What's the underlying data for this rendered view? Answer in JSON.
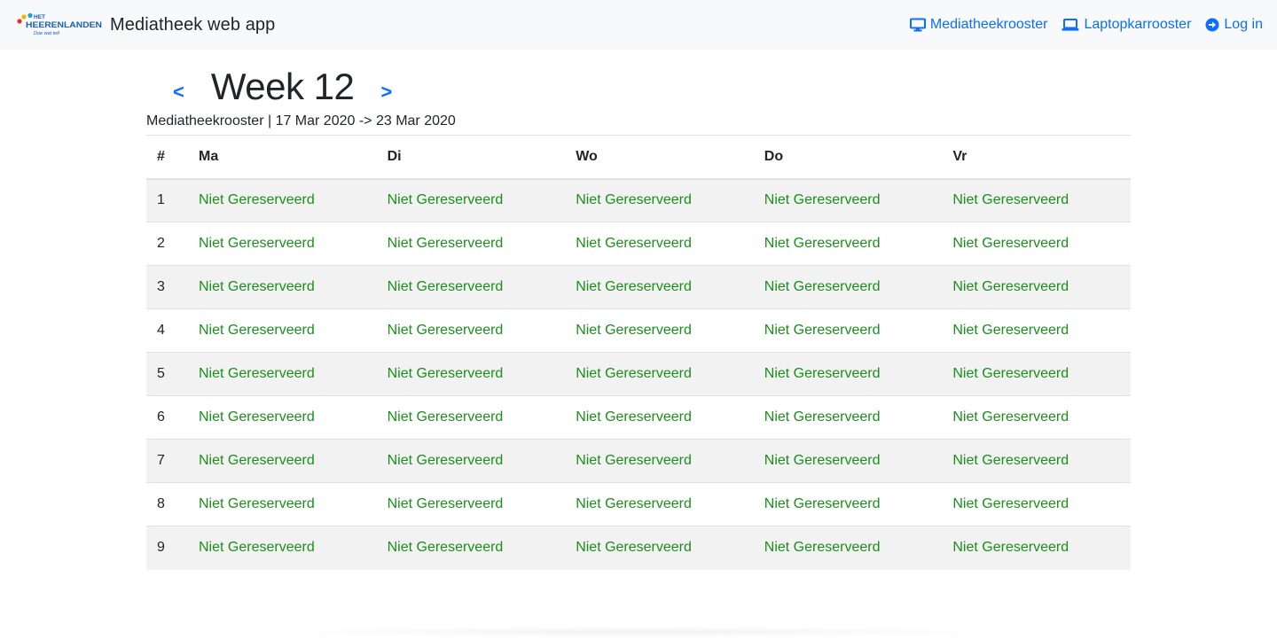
{
  "navbar": {
    "brand_title": "Mediatheek web app",
    "logo_text_top": "HET",
    "logo_text_main": "HEERENLANDEN",
    "logo_text_sub": "Doe wat telt",
    "links": [
      {
        "label": "Mediatheekrooster",
        "icon": "monitor-icon"
      },
      {
        "label": "Laptopkarrooster",
        "icon": "laptop-icon"
      },
      {
        "label": "Log in",
        "icon": "sign-in-icon"
      }
    ]
  },
  "week": {
    "prev_label": "<",
    "title": "Week 12",
    "next_label": ">",
    "subtitle": "Mediatheekrooster | 17 Mar 2020 -> 23 Mar 2020"
  },
  "table": {
    "headers": [
      "#",
      "Ma",
      "Di",
      "Wo",
      "Do",
      "Vr"
    ],
    "rows": [
      {
        "num": "1",
        "slots": [
          "Niet Gereserveerd",
          "Niet Gereserveerd",
          "Niet Gereserveerd",
          "Niet Gereserveerd",
          "Niet Gereserveerd"
        ]
      },
      {
        "num": "2",
        "slots": [
          "Niet Gereserveerd",
          "Niet Gereserveerd",
          "Niet Gereserveerd",
          "Niet Gereserveerd",
          "Niet Gereserveerd"
        ]
      },
      {
        "num": "3",
        "slots": [
          "Niet Gereserveerd",
          "Niet Gereserveerd",
          "Niet Gereserveerd",
          "Niet Gereserveerd",
          "Niet Gereserveerd"
        ]
      },
      {
        "num": "4",
        "slots": [
          "Niet Gereserveerd",
          "Niet Gereserveerd",
          "Niet Gereserveerd",
          "Niet Gereserveerd",
          "Niet Gereserveerd"
        ]
      },
      {
        "num": "5",
        "slots": [
          "Niet Gereserveerd",
          "Niet Gereserveerd",
          "Niet Gereserveerd",
          "Niet Gereserveerd",
          "Niet Gereserveerd"
        ]
      },
      {
        "num": "6",
        "slots": [
          "Niet Gereserveerd",
          "Niet Gereserveerd",
          "Niet Gereserveerd",
          "Niet Gereserveerd",
          "Niet Gereserveerd"
        ]
      },
      {
        "num": "7",
        "slots": [
          "Niet Gereserveerd",
          "Niet Gereserveerd",
          "Niet Gereserveerd",
          "Niet Gereserveerd",
          "Niet Gereserveerd"
        ]
      },
      {
        "num": "8",
        "slots": [
          "Niet Gereserveerd",
          "Niet Gereserveerd",
          "Niet Gereserveerd",
          "Niet Gereserveerd",
          "Niet Gereserveerd"
        ]
      },
      {
        "num": "9",
        "slots": [
          "Niet Gereserveerd",
          "Niet Gereserveerd",
          "Niet Gereserveerd",
          "Niet Gereserveerd",
          "Niet Gereserveerd"
        ]
      }
    ]
  },
  "colors": {
    "link": "#0d6efd",
    "available": "#1a8f1a",
    "navbar_bg": "#f8f9fa",
    "stripe": "#f2f2f2"
  }
}
